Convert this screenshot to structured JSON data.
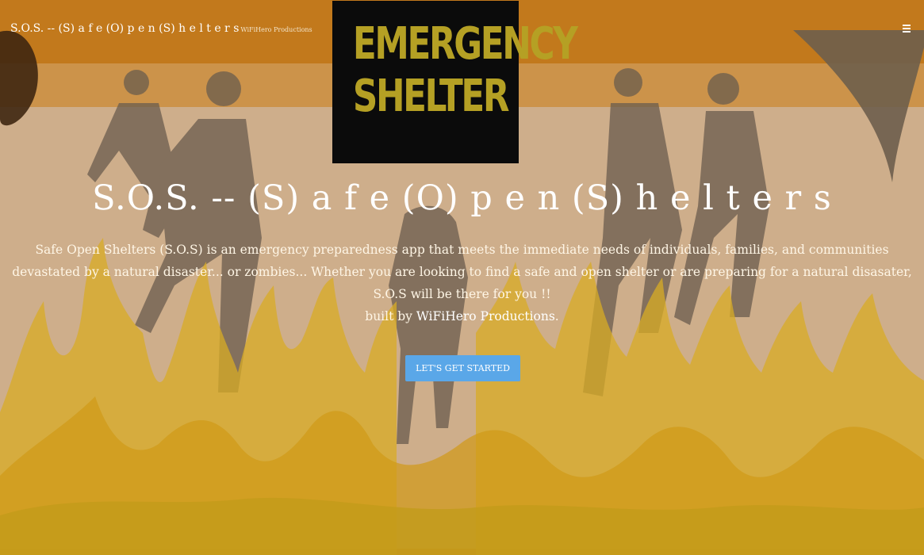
{
  "nav": {
    "brand": "S.O.S. -- (S) a f e (O) p e n (S) h e l t e r s",
    "brand_sub": "WiFiHero Productions"
  },
  "sign": {
    "line1": "EMERGENCY",
    "line2": "SHELTER"
  },
  "hero": {
    "title": "S.O.S. -- (S) a f e (O) p e n (S) h e l t e r s",
    "description": "Safe Open Shelters (S.O.S) is an emergency preparedness app that meets the immediate needs of individuals, families, and communities devastated by a natural disaster... or zombies... Whether you are looking to find a safe and open shelter or are preparing for a natural disasater, S.O.S will be there for you !!",
    "built_prefix": "built by ",
    "built_link": "WiFiHero Productions",
    "built_suffix": ".",
    "cta": "LET'S GET STARTED"
  },
  "colors": {
    "accent": "#5aa7e8",
    "sign_text": "#b5a024",
    "background_top": "#c97d1c"
  },
  "icons": {
    "menu": "hamburger-icon"
  }
}
